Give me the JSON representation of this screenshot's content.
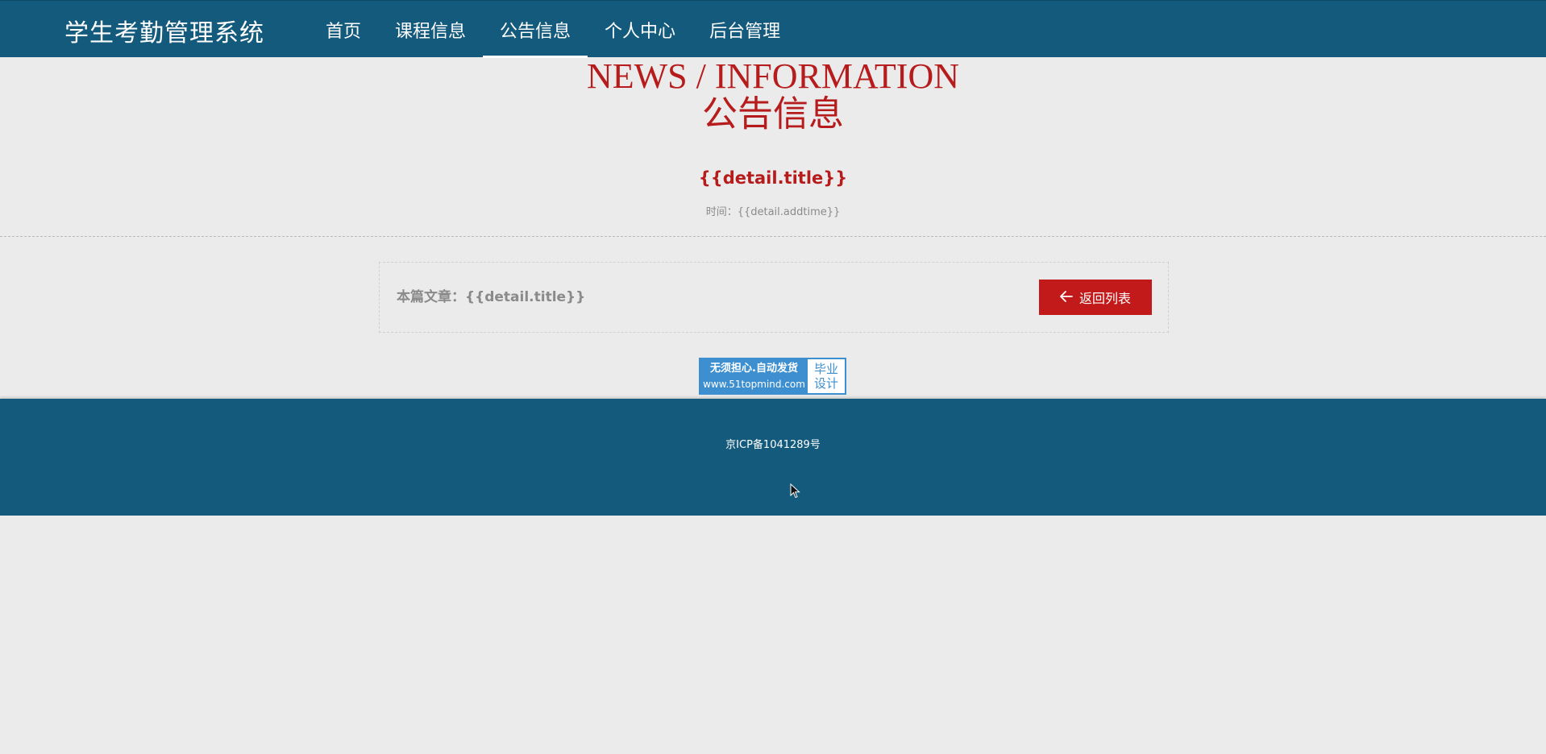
{
  "header": {
    "logo": "学生考勤管理系统",
    "nav": [
      {
        "label": "首页",
        "active": false
      },
      {
        "label": "课程信息",
        "active": false
      },
      {
        "label": "公告信息",
        "active": true
      },
      {
        "label": "个人中心",
        "active": false
      },
      {
        "label": "后台管理",
        "active": false
      }
    ]
  },
  "page": {
    "heading_en": "NEWS / INFORMATION",
    "heading_cn": "公告信息",
    "article_title": "{{detail.title}}",
    "article_time": "时间：{{detail.addtime}}"
  },
  "info_box": {
    "label": "本篇文章：{{detail.title}}",
    "back_button": "返回列表",
    "back_icon": "arrow-left-icon"
  },
  "ad": {
    "line1": "无须担心.自动发货",
    "line2": "www.51topmind.com",
    "right_line1": "毕业",
    "right_line2": "设计"
  },
  "footer": {
    "icp": "京ICP备1041289号"
  },
  "colors": {
    "primary": "#135a7c",
    "accent_red": "#b71c1c",
    "button_red": "#c21a1a",
    "background": "#ebebeb",
    "ad_blue": "#3d8fd0"
  }
}
